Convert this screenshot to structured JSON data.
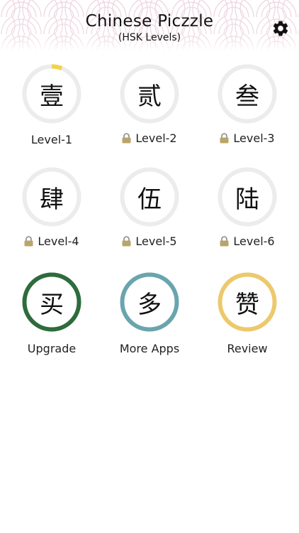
{
  "header": {
    "title": "Chinese Piczzle",
    "subtitle": "(HSK Levels)",
    "settings_icon": "gear-icon"
  },
  "colors": {
    "ring_gray": "#ececec",
    "progress_yellow": "#f2d24a",
    "upgrade_green": "#2e6b3d",
    "more_apps_teal": "#6aa5ae",
    "review_gold": "#ecc96c",
    "lock_gold": "#b8a56a",
    "wave_pink": "#eed3e0"
  },
  "levels": [
    {
      "glyph": "壹",
      "label": "Level-1",
      "locked": false,
      "progress": 0.06
    },
    {
      "glyph": "贰",
      "label": "Level-2",
      "locked": true
    },
    {
      "glyph": "叁",
      "label": "Level-3",
      "locked": true
    },
    {
      "glyph": "肆",
      "label": "Level-4",
      "locked": true
    },
    {
      "glyph": "伍",
      "label": "Level-5",
      "locked": true
    },
    {
      "glyph": "陆",
      "label": "Level-6",
      "locked": true
    }
  ],
  "actions": [
    {
      "glyph": "买",
      "label": "Upgrade"
    },
    {
      "glyph": "多",
      "label": "More Apps"
    },
    {
      "glyph": "赞",
      "label": "Review"
    }
  ]
}
